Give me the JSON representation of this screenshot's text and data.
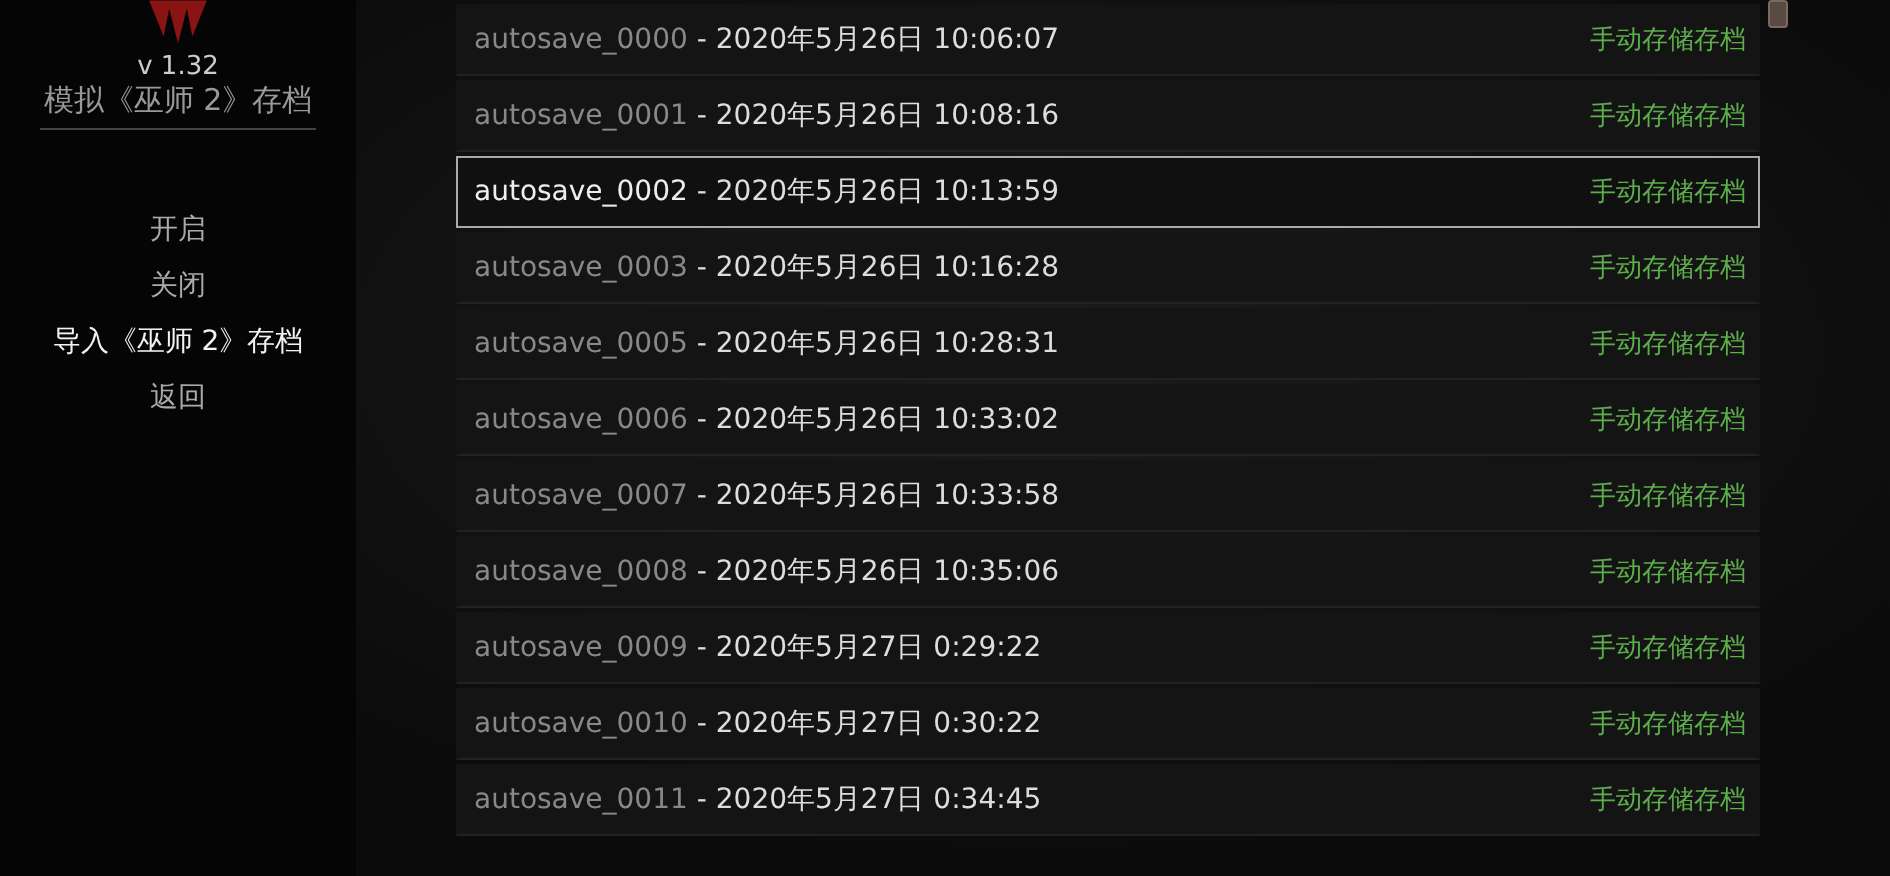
{
  "sidebar": {
    "version": "v 1.32",
    "title": "模拟《巫师 2》存档",
    "menu": [
      {
        "label": "开启",
        "selected": false
      },
      {
        "label": "关闭",
        "selected": false
      },
      {
        "label": "导入《巫师 2》存档",
        "selected": true
      },
      {
        "label": "返回",
        "selected": false
      }
    ]
  },
  "saves": [
    {
      "name": "autosave_0000",
      "date": " - 2020年5月26日 10:06:07",
      "type": "手动存储存档",
      "selected": false
    },
    {
      "name": "autosave_0001",
      "date": " - 2020年5月26日 10:08:16",
      "type": "手动存储存档",
      "selected": false
    },
    {
      "name": "autosave_0002",
      "date": " - 2020年5月26日 10:13:59",
      "type": "手动存储存档",
      "selected": true
    },
    {
      "name": "autosave_0003",
      "date": " - 2020年5月26日 10:16:28",
      "type": "手动存储存档",
      "selected": false
    },
    {
      "name": "autosave_0005",
      "date": " - 2020年5月26日 10:28:31",
      "type": "手动存储存档",
      "selected": false
    },
    {
      "name": "autosave_0006",
      "date": " - 2020年5月26日 10:33:02",
      "type": "手动存储存档",
      "selected": false
    },
    {
      "name": "autosave_0007",
      "date": " - 2020年5月26日 10:33:58",
      "type": "手动存储存档",
      "selected": false
    },
    {
      "name": "autosave_0008",
      "date": " - 2020年5月26日 10:35:06",
      "type": "手动存储存档",
      "selected": false
    },
    {
      "name": "autosave_0009",
      "date": " - 2020年5月27日 0:29:22",
      "type": "手动存储存档",
      "selected": false
    },
    {
      "name": "autosave_0010",
      "date": " - 2020年5月27日 0:30:22",
      "type": "手动存储存档",
      "selected": false
    },
    {
      "name": "autosave_0011",
      "date": " - 2020年5月27日 0:34:45",
      "type": "手动存储存档",
      "selected": false
    }
  ]
}
